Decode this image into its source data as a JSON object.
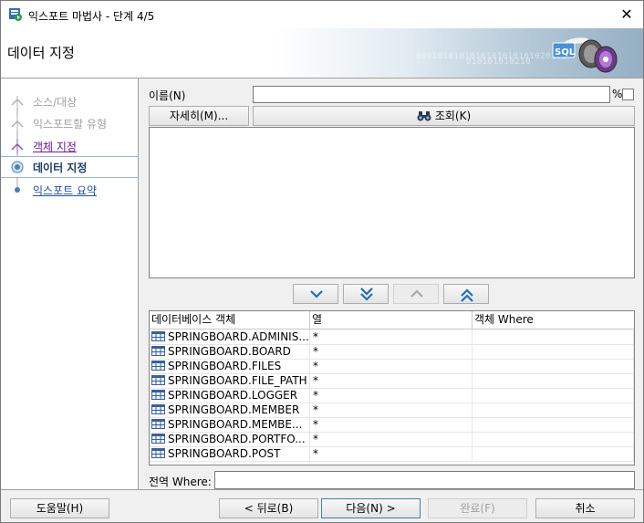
{
  "window": {
    "title": "익스포트 마법사 - 단계 4/5",
    "close_symbol": "✕"
  },
  "header": {
    "step_title": "데이터 지정",
    "binary_text_1": "0001010101010101010101020101",
    "binary_text_2": "010101010210"
  },
  "steps": [
    {
      "label": "소스/대상",
      "state": "disabled"
    },
    {
      "label": "익스포트할 유형",
      "state": "disabled"
    },
    {
      "label": "객체 지정",
      "state": "done"
    },
    {
      "label": "데이터 지정",
      "state": "current"
    },
    {
      "label": "익스포트 요약",
      "state": "link"
    }
  ],
  "filter": {
    "name_label": "이름(N)",
    "name_value": "",
    "percent_label": "%",
    "wildcard_checked": false,
    "more_button": "자세히(M)...",
    "lookup_button": "조회(K)"
  },
  "move_buttons": [
    {
      "icon": "chevron-down-icon",
      "enabled": true
    },
    {
      "icon": "double-chevron-down-icon",
      "enabled": true
    },
    {
      "icon": "chevron-up-icon",
      "enabled": false
    },
    {
      "icon": "double-chevron-up-icon",
      "enabled": true
    }
  ],
  "table": {
    "columns": [
      "데이터베이스 객체",
      "열",
      "객체 Where"
    ],
    "rows": [
      {
        "object": "SPRINGBOARD.ADMINIS...",
        "column": "*",
        "where": ""
      },
      {
        "object": "SPRINGBOARD.BOARD",
        "column": "*",
        "where": ""
      },
      {
        "object": "SPRINGBOARD.FILES",
        "column": "*",
        "where": ""
      },
      {
        "object": "SPRINGBOARD.FILE_PATH",
        "column": "*",
        "where": ""
      },
      {
        "object": "SPRINGBOARD.LOGGER",
        "column": "*",
        "where": ""
      },
      {
        "object": "SPRINGBOARD.MEMBER",
        "column": "*",
        "where": ""
      },
      {
        "object": "SPRINGBOARD.MEMBE...",
        "column": "*",
        "where": ""
      },
      {
        "object": "SPRINGBOARD.PORTFO...",
        "column": "*",
        "where": ""
      },
      {
        "object": "SPRINGBOARD.POST",
        "column": "*",
        "where": ""
      }
    ]
  },
  "global_where": {
    "label": "전역 Where:",
    "value": ""
  },
  "footer": {
    "help_button": "도움말(H)",
    "back_button": "< 뒤로(B)",
    "next_button": "다음(N) >",
    "finish_button": "완료(F)",
    "cancel_button": "취소"
  },
  "colors": {
    "accent": "#3c7fb1",
    "visited_link": "#6a1b9a",
    "link": "#1f4fa8"
  }
}
